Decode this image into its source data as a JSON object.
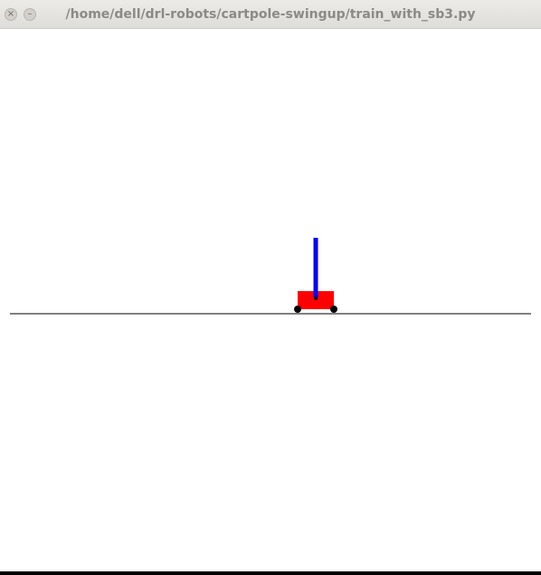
{
  "window": {
    "title": "/home/dell/drl-robots/cartpole-swingup/train_with_sb3.py",
    "close_glyph": "×",
    "minimize_glyph": "–"
  },
  "scene": {
    "cart_color": "#ff0000",
    "pole_color": "#0000ff",
    "track_color": "#000000",
    "wheel_color": "#000000",
    "background_color": "#ffffff"
  }
}
